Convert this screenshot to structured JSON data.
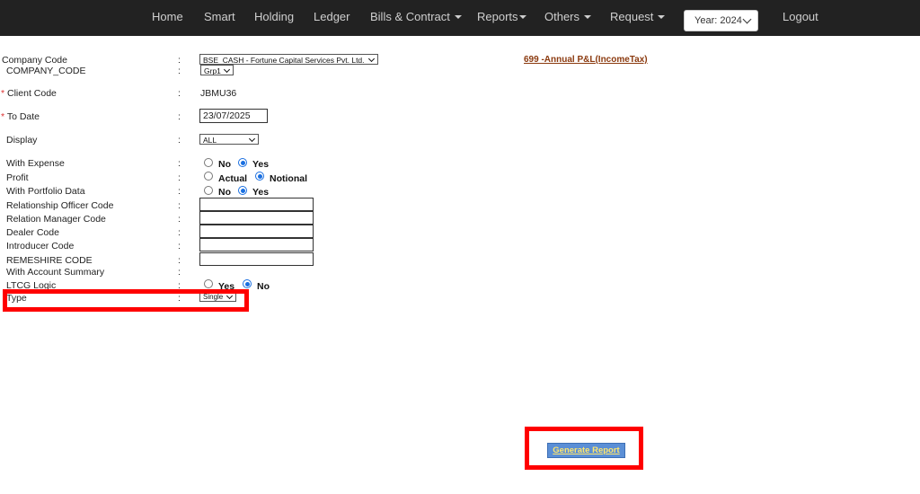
{
  "nav": {
    "home": "Home",
    "smart": "Smart",
    "holding": "Holding",
    "ledger": "Ledger",
    "bills": "Bills & Contract",
    "reports": "Reports",
    "others": "Others",
    "request": "Request",
    "year": "Year: 2024",
    "logout": "Logout"
  },
  "report_link": "699 -Annual P&L(IncomeTax)",
  "form": {
    "company_code_label": "Company Code",
    "company_code_value": "BSE_CASH - Fortune Capital Services Pvt. Ltd.",
    "company_code2_label": "COMPANY_CODE",
    "company_code2_value": "Grp1",
    "required_marker": "*",
    "client_code_label": "Client Code",
    "client_code_value": "JBMU36",
    "to_date_label": "To Date",
    "to_date_value": "23/07/2025",
    "display_label": "Display",
    "display_value": "ALL",
    "with_expense_label": "With Expense",
    "with_expense_options": [
      "No",
      "Yes"
    ],
    "with_expense_selected": "Yes",
    "profit_label": "Profit",
    "profit_options": [
      "Actual",
      "Notional"
    ],
    "profit_selected": "Notional",
    "portfolio_label": "With Portfolio Data",
    "portfolio_options": [
      "No",
      "Yes"
    ],
    "portfolio_selected": "Yes",
    "ro_code_label": "Relationship Officer Code",
    "rm_code_label": "Relation Manager Code",
    "dealer_code_label": "Dealer Code",
    "introducer_code_label": "Introducer Code",
    "remeshire_code_label": "REMESHIRE CODE",
    "account_summary_label": "With Account Summary",
    "ltcg_label": "LTCG Logic",
    "ltcg_options": [
      "Yes",
      "No"
    ],
    "ltcg_selected": "No",
    "type_label": "Type",
    "type_value": "Single",
    "colon": ":"
  },
  "generate_button": "Generate Report",
  "colors": {
    "topbar": "#222222",
    "highlight": "#ff0000",
    "button": "#5b8fd6",
    "button_text": "#ffe66d",
    "link": "#8b3a0f",
    "radio_selected": "#1a6fe0"
  }
}
